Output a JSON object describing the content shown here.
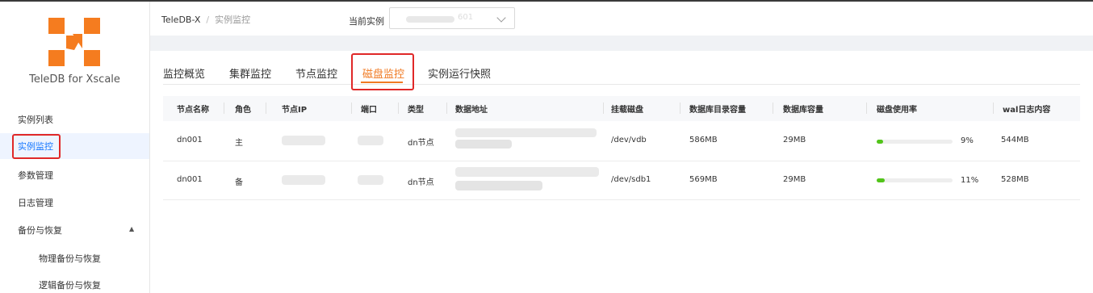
{
  "brand": {
    "name": "TeleDB for Xscale",
    "logo_color": "#f57c1f"
  },
  "sidebar": {
    "items": [
      {
        "label": "实例列表"
      },
      {
        "label": "实例监控",
        "active": true
      },
      {
        "label": "参数管理"
      },
      {
        "label": "日志管理"
      },
      {
        "label": "备份与恢复",
        "expanded": true
      },
      {
        "label": "物理备份与恢复"
      },
      {
        "label": "逻辑备份与恢复"
      }
    ],
    "expand_icon": "caret-up-icon"
  },
  "header": {
    "breadcrumb": [
      "TeleDB-X",
      "实例监控"
    ],
    "instance_label": "当前实例",
    "instance_value_suffix": "601"
  },
  "tabs": [
    {
      "label": "监控概览"
    },
    {
      "label": "集群监控"
    },
    {
      "label": "节点监控"
    },
    {
      "label": "磁盘监控",
      "active": true
    },
    {
      "label": "实例运行快照"
    }
  ],
  "table": {
    "columns": [
      "节点名称",
      "角色",
      "节点IP",
      "端口",
      "类型",
      "数据地址",
      "挂载磁盘",
      "数据库目录容量",
      "数据库容量",
      "磁盘使用率",
      "wal日志内容"
    ],
    "rows": [
      {
        "node": "dn001",
        "role": "主",
        "type": "dn节点",
        "disk": "/dev/vdb",
        "dir_size": "586MB",
        "db_size": "29MB",
        "usage": 9,
        "usage_text": "9%",
        "wal": "544MB"
      },
      {
        "node": "dn001",
        "role": "备",
        "type": "dn节点",
        "disk": "/dev/sdb1",
        "dir_size": "569MB",
        "db_size": "29MB",
        "usage": 11,
        "usage_text": "11%",
        "wal": "528MB"
      }
    ]
  },
  "colors": {
    "accent": "#f07a23",
    "active_link": "#1677ff",
    "progress": "#52c41a",
    "highlight_box": "#e02828"
  }
}
